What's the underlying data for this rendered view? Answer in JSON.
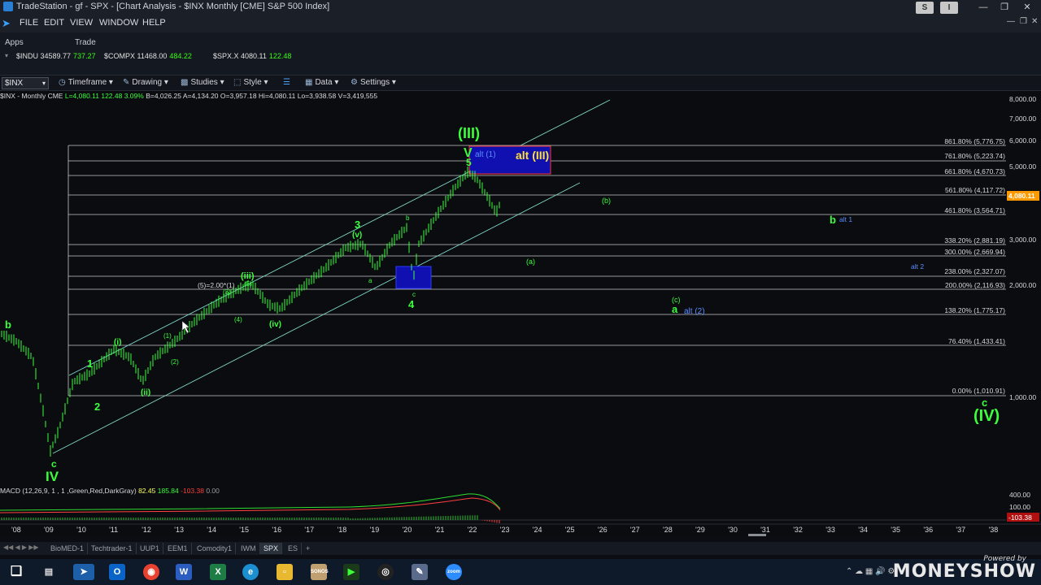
{
  "window": {
    "title": "TradeStation - gf - SPX - [Chart Analysis - $INX Monthly [CME] S&P 500 Index]",
    "badge_s": "S",
    "badge_i": "I"
  },
  "menu": [
    "FILE",
    "EDIT",
    "VIEW",
    "WINDOW",
    "HELP"
  ],
  "apps_bar": {
    "apps": "Apps",
    "trade": "Trade"
  },
  "quotes": [
    {
      "symbol": "$INDU 34589.77",
      "change": "737.27"
    },
    {
      "symbol": "$COMPX 11468.00",
      "change": "484.22"
    },
    {
      "symbol": "$SPX.X 4080.11",
      "change": "122.48"
    }
  ],
  "toolbar": {
    "symbol": "$INX",
    "timeframe": "Timeframe",
    "drawing": "Drawing",
    "studies": "Studies",
    "style": "Style",
    "data": "Data",
    "settings": "Settings"
  },
  "chart_info": {
    "prefix": "$INX - Monthly  CME",
    "last": "L=4,080.11 122.48 3.09%",
    "rest": "B=4,026.25  A=4,134.20  O=3,957.18  Hi=4,080.11  Lo=3,938.58  V=3,419,555"
  },
  "macd": {
    "label": "MACD (12,26,9, 1 , 1 ,Green,Red,DarkGray)",
    "v1": "82.45",
    "v2": "185.84",
    "v3": "-103.38",
    "v4": "0.00",
    "axis": [
      "400.00",
      "100.00",
      "-103.38"
    ]
  },
  "price_axis": [
    "8,000.00",
    "7,000.00",
    "6,000.00",
    "5,000.00",
    "4,080.11",
    "3,000.00",
    "2,000.00",
    "1,000.00"
  ],
  "fib_levels": [
    {
      "label": "861.80% (5,776.75)"
    },
    {
      "label": "761.80% (5,223.74)"
    },
    {
      "label": "661.80% (4,670.73)"
    },
    {
      "label": "561.80% (4,117.72)"
    },
    {
      "label": "461.80% (3,564.71)"
    },
    {
      "label": "338.20% (2,881.19)"
    },
    {
      "label": "300.00% (2,669.94)"
    },
    {
      "label": "238.00% (2,327.07)"
    },
    {
      "label": "200.00% (2,116.93)"
    },
    {
      "label": "138.20% (1,775.17)"
    },
    {
      "label": "76.40% (1,433.41)"
    },
    {
      "label": "0.00% (1,010.91)"
    }
  ],
  "x_axis": [
    "'08",
    "'09",
    "'10",
    "'11",
    "'12",
    "'13",
    "'14",
    "'15",
    "'16",
    "'17",
    "'18",
    "'19",
    "'20",
    "'21",
    "'22",
    "'23",
    "'24",
    "'25",
    "'26",
    "'27",
    "'28",
    "'29",
    "'30",
    "'31",
    "'32",
    "'33",
    "'34",
    "'35",
    "'36",
    "'37",
    "'38"
  ],
  "wave_labels": [
    {
      "text": "(III)"
    },
    {
      "text": "V"
    },
    {
      "text": "5"
    },
    {
      "text": "alt (1)"
    },
    {
      "text": "alt (III)"
    },
    {
      "text": "(b)"
    },
    {
      "text": "b"
    },
    {
      "text": "alt 1"
    },
    {
      "text": "(a)"
    },
    {
      "text": "alt 2"
    },
    {
      "text": "(c)"
    },
    {
      "text": "a"
    },
    {
      "text": "alt (2)"
    },
    {
      "text": "c"
    },
    {
      "text": "(IV)"
    },
    {
      "text": "3"
    },
    {
      "text": "(v)"
    },
    {
      "text": "b"
    },
    {
      "text": "a"
    },
    {
      "text": "c"
    },
    {
      "text": "4"
    },
    {
      "text": "(iii)"
    },
    {
      "text": "(5)=2.00*(1)"
    },
    {
      "text": "(5)"
    },
    {
      "text": "(3)"
    },
    {
      "text": "(4)"
    },
    {
      "text": "(iv)"
    },
    {
      "text": "(i)"
    },
    {
      "text": "(1)"
    },
    {
      "text": "(2)"
    },
    {
      "text": "1"
    },
    {
      "text": "2"
    },
    {
      "text": "(ii)"
    },
    {
      "text": "b"
    },
    {
      "text": "c"
    },
    {
      "text": "IV"
    }
  ],
  "sheet_tabs": [
    "BioMED-1",
    "Techtrader-1",
    "UUP1",
    "EEM1",
    "Comodity1",
    "IWM",
    "SPX",
    "ES",
    "+"
  ],
  "taskbar_icons": [
    "windows-start",
    "task-view",
    "tradestation",
    "outlook",
    "chrome",
    "word",
    "excel",
    "edge",
    "file-explorer",
    "sonos",
    "terminal",
    "obs",
    "paint",
    "zoom"
  ],
  "brand": {
    "powered_by": "Powered by",
    "name": "MONEYSHOW"
  },
  "colors": {
    "wave_green": "#3cff3c",
    "alt_blue": "#5b8cff",
    "price_label_bg": "#ff9900",
    "alt_box": "#1010b0"
  }
}
